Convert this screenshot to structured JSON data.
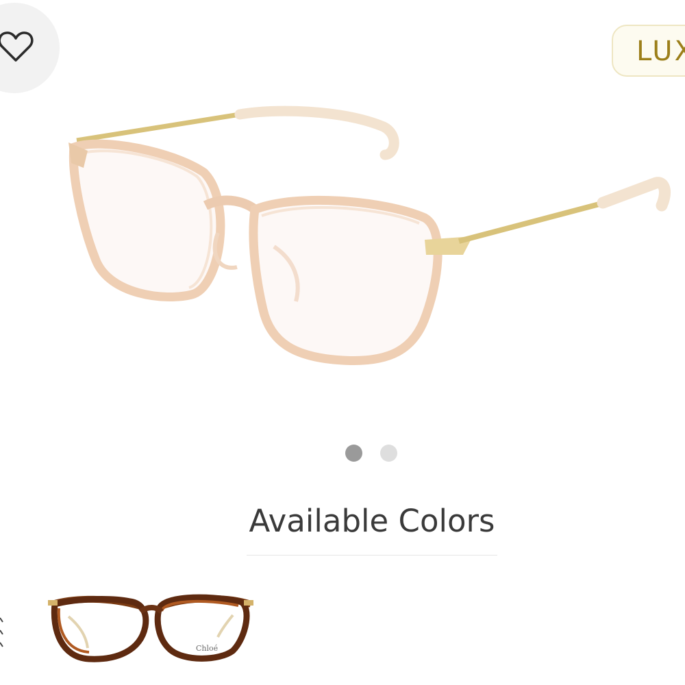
{
  "header": {
    "favorite_icon": "heart-outline-icon",
    "badge_label": "LUX",
    "colors": {
      "badge_text": "#9c7f1a",
      "badge_border": "#eee6c2",
      "badge_bg": "#fdfbf0",
      "fav_bg": "#f2f2f2"
    }
  },
  "gallery": {
    "slide_count": 2,
    "active_index": 0,
    "colors": {
      "active": "#9a9a9a",
      "inactive": "#dedede"
    }
  },
  "available_colors": {
    "title": "Available Colors",
    "items": [
      {
        "frame_color": "tortoise",
        "temple_logo": "Chloé"
      }
    ]
  }
}
